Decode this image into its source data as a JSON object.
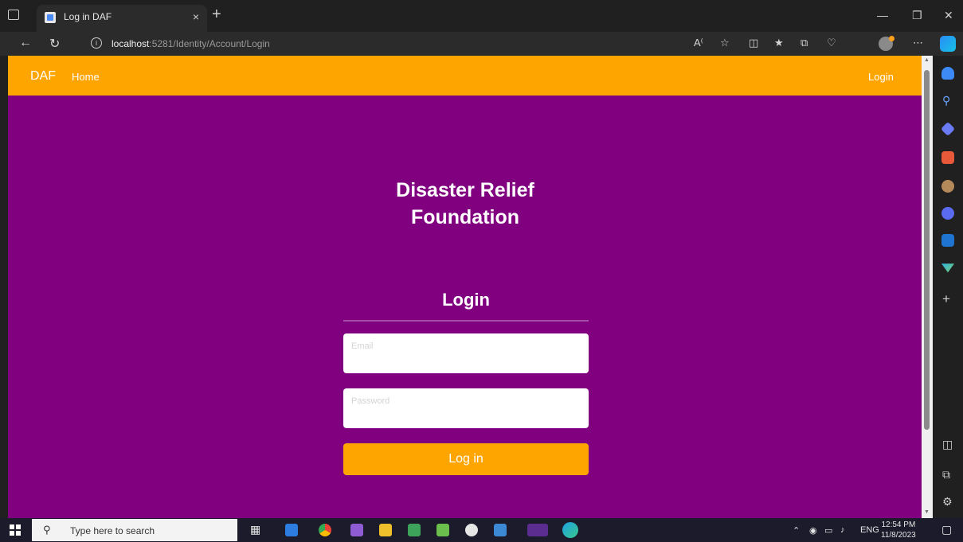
{
  "browser": {
    "tab_title": "Log in DAF",
    "tab_close": "×",
    "new_tab": "+",
    "url_host": "localhost",
    "url_rest": ":5281/Identity/Account/Login"
  },
  "navbar": {
    "brand": "DAF",
    "home": "Home",
    "login": "Login"
  },
  "page": {
    "org_title": "Disaster Relief Foundation",
    "form_title": "Login",
    "email_label": "Email",
    "password_label": "Password",
    "submit": "Log in"
  },
  "taskbar": {
    "search_placeholder": "Type here to search",
    "language": "ENG",
    "time": "12:54 PM",
    "date": "11/8/2023"
  },
  "colors": {
    "page_bg": "#800080",
    "accent": "#ffa500"
  }
}
